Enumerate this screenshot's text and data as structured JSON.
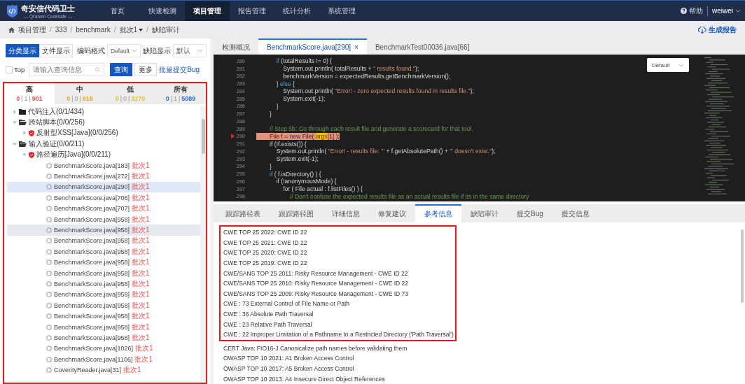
{
  "header": {
    "logo_title": "奇安信代码卫士",
    "logo_subtitle": "— Qi'anxin Codesafe —",
    "nav": [
      {
        "label": "首页",
        "selected": false
      },
      {
        "label": "快速检测",
        "selected": false
      },
      {
        "label": "项目管理",
        "selected": true
      },
      {
        "label": "报告管理",
        "selected": false
      },
      {
        "label": "统计分析",
        "selected": false
      },
      {
        "label": "系统管理",
        "selected": false
      }
    ],
    "help": "帮助",
    "user": "weiwei"
  },
  "breadcrumb": {
    "separator": "/",
    "items": [
      {
        "label": "项目管理",
        "kind": "text"
      },
      {
        "label": "333",
        "kind": "text"
      },
      {
        "label": "benchmark",
        "kind": "text"
      },
      {
        "label": "批次1",
        "kind": "dropdown"
      },
      {
        "label": "缺陷审计",
        "kind": "text"
      }
    ],
    "report_button": "生成报告"
  },
  "left": {
    "view_toggle": [
      {
        "label": "分类显示",
        "selected": true
      },
      {
        "label": "文件显示",
        "selected": false
      }
    ],
    "encoding": {
      "label": "编码格式",
      "value": "Default"
    },
    "defect_display": {
      "label": "缺陷显示",
      "value": "默认"
    },
    "top": {
      "label": "Top",
      "checked": false
    },
    "search": {
      "placeholder": "请输入查询信息"
    },
    "query_button": "查询",
    "more_button": "更多",
    "batch_link": "批量提交Bug",
    "red_frame": true,
    "count_separator": "|",
    "severity_tabs": [
      {
        "label": "高",
        "counts": [
          "0",
          "1",
          "901"
        ],
        "color": "#f0514f",
        "selected": true
      },
      {
        "label": "中",
        "counts": [
          "0",
          "0",
          "918"
        ],
        "color": "#f5a623",
        "selected": false
      },
      {
        "label": "低",
        "counts": [
          "0",
          "0",
          "3270"
        ],
        "color": "#f2c01c",
        "selected": false
      },
      {
        "label": "所有",
        "counts": [
          "0",
          "1",
          "5089"
        ],
        "color": "#2a6fd6",
        "selected": false
      }
    ],
    "tree": [
      {
        "kind": "folder",
        "label": "代码注入(0/1/434)",
        "expanded": false
      },
      {
        "kind": "folder",
        "label": "跨站脚本(0/0/256)",
        "expanded": true,
        "children": [
          {
            "kind": "rule",
            "label": "反射型XSS[Java](0/0/256)",
            "expanded": false
          }
        ]
      },
      {
        "kind": "folder",
        "label": "输入验证(0/0/211)",
        "expanded": true,
        "children": [
          {
            "kind": "rule",
            "label": "路径遍历[Java](0/0/211)",
            "expanded": true,
            "children": [
              {
                "kind": "issue",
                "file": "BenchmarkScore.java[183]",
                "batch": "批次1",
                "selected": false,
                "hovered": false
              },
              {
                "kind": "issue",
                "file": "BenchmarkScore.java[272]",
                "batch": "批次1",
                "selected": false,
                "hovered": false
              },
              {
                "kind": "issue",
                "file": "BenchmarkScore.java[290]",
                "batch": "批次1",
                "selected": true,
                "hovered": false
              },
              {
                "kind": "issue",
                "file": "BenchmarkScore.java[706]",
                "batch": "批次1",
                "selected": false,
                "hovered": false
              },
              {
                "kind": "issue",
                "file": "BenchmarkScore.java[707]",
                "batch": "批次1",
                "selected": false,
                "hovered": false
              },
              {
                "kind": "issue",
                "file": "BenchmarkScore.java[958]",
                "batch": "批次1",
                "selected": false,
                "hovered": false
              },
              {
                "kind": "issue",
                "file": "BenchmarkScore.java[958]",
                "batch": "批次1",
                "selected": false,
                "hovered": true
              },
              {
                "kind": "issue",
                "file": "BenchmarkScore.java[958]",
                "batch": "批次1",
                "selected": false,
                "hovered": false
              },
              {
                "kind": "issue",
                "file": "BenchmarkScore.java[958]",
                "batch": "批次1",
                "selected": false,
                "hovered": false
              },
              {
                "kind": "issue",
                "file": "BenchmarkScore.java[958]",
                "batch": "批次1",
                "selected": false,
                "hovered": false
              },
              {
                "kind": "issue",
                "file": "BenchmarkScore.java[958]",
                "batch": "批次1",
                "selected": false,
                "hovered": false
              },
              {
                "kind": "issue",
                "file": "BenchmarkScore.java[958]",
                "batch": "批次1",
                "selected": false,
                "hovered": false
              },
              {
                "kind": "issue",
                "file": "BenchmarkScore.java[958]",
                "batch": "批次1",
                "selected": false,
                "hovered": false
              },
              {
                "kind": "issue",
                "file": "BenchmarkScore.java[958]",
                "batch": "批次1",
                "selected": false,
                "hovered": false
              },
              {
                "kind": "issue",
                "file": "BenchmarkScore.java[958]",
                "batch": "批次1",
                "selected": false,
                "hovered": false
              },
              {
                "kind": "issue",
                "file": "BenchmarkScore.java[958]",
                "batch": "批次1",
                "selected": false,
                "hovered": false
              },
              {
                "kind": "issue",
                "file": "BenchmarkScore.java[958]",
                "batch": "批次1",
                "selected": false,
                "hovered": false
              },
              {
                "kind": "issue",
                "file": "BenchmarkScore.java[1026]",
                "batch": "批次1",
                "selected": false,
                "hovered": false
              },
              {
                "kind": "issue",
                "file": "BenchmarkScore.java[1106]",
                "batch": "批次1",
                "selected": false,
                "hovered": false
              },
              {
                "kind": "issue",
                "file": "CoverityReader.java[31]",
                "batch": "批次1",
                "selected": false,
                "hovered": false
              }
            ]
          }
        ]
      }
    ]
  },
  "code_tabs": [
    {
      "label": "检测概况",
      "selected": false
    },
    {
      "label": "BenchmarkScore.java[290]",
      "selected": true,
      "close": "×"
    },
    {
      "label": "BenchmarkTest00036.java[66]",
      "selected": false
    }
  ],
  "code": {
    "theme_select": "Default",
    "lines": [
      {
        "number": "280",
        "segments": [
          {
            "text": "            if",
            "kind": "keyword"
          },
          {
            "text": " (totalResults != 0) {",
            "kind": "plain"
          }
        ]
      },
      {
        "number": "281",
        "segments": [
          {
            "text": "                System.out.println( totalResults + ",
            "kind": "plain"
          },
          {
            "text": "\" results found.\"",
            "kind": "string"
          },
          {
            "text": ");",
            "kind": "plain"
          }
        ]
      },
      {
        "number": "282",
        "segments": [
          {
            "text": "                benchmarkVersion = expectedResults.getBenchmarkVersion();",
            "kind": "plain"
          }
        ]
      },
      {
        "number": "283",
        "segments": [
          {
            "text": "            } ",
            "kind": "plain"
          },
          {
            "text": "else",
            "kind": "keyword"
          },
          {
            "text": " {",
            "kind": "plain"
          }
        ]
      },
      {
        "number": "284",
        "segments": [
          {
            "text": "                System.out.println( ",
            "kind": "plain"
          },
          {
            "text": "\"Error! - zero expected results found in results file.\"",
            "kind": "string"
          },
          {
            "text": ");",
            "kind": "plain"
          }
        ]
      },
      {
        "number": "285",
        "segments": [
          {
            "text": "                System.exit(-1);",
            "kind": "plain"
          }
        ]
      },
      {
        "number": "286",
        "segments": [
          {
            "text": "            }",
            "kind": "plain"
          }
        ]
      },
      {
        "number": "287",
        "segments": [
          {
            "text": "        }",
            "kind": "plain"
          }
        ]
      },
      {
        "number": "288"
      },
      {
        "number": "289",
        "segments": [
          {
            "text": "        // Step 5b: Go through each result file and generate a scorecard for that tool.",
            "kind": "comment"
          }
        ]
      },
      {
        "number": "290",
        "highlighted": true,
        "breakpoint": true,
        "segments": [
          {
            "text": "        File f = ",
            "kind": "plain"
          },
          {
            "text": "new",
            "kind": "keyword"
          },
          {
            "text": " File( ",
            "kind": "plain"
          },
          {
            "text": "args",
            "kind": "match"
          },
          {
            "text": "[1] );",
            "kind": "plain"
          }
        ]
      },
      {
        "number": "291",
        "segments": [
          {
            "text": "        if (!f.exists()) {",
            "kind": "plain"
          }
        ]
      },
      {
        "number": "292",
        "segments": [
          {
            "text": "            System.out.println( ",
            "kind": "plain"
          },
          {
            "text": "\"Error! - results file: '\"",
            "kind": "string"
          },
          {
            "text": " + f.getAbsolutePath() + ",
            "kind": "plain"
          },
          {
            "text": "\"' doesn't exist.\"",
            "kind": "string"
          },
          {
            "text": ");",
            "kind": "plain"
          }
        ]
      },
      {
        "number": "293",
        "segments": [
          {
            "text": "            System.exit(-1);",
            "kind": "plain"
          }
        ]
      },
      {
        "number": "294",
        "segments": [
          {
            "text": "        }",
            "kind": "plain"
          }
        ]
      },
      {
        "number": "295",
        "segments": [
          {
            "text": "        if",
            "kind": "keyword"
          },
          {
            "text": " ( f.isDirectory() ) {",
            "kind": "plain"
          }
        ]
      },
      {
        "number": "296",
        "segments": [
          {
            "text": "            if (!anonymousMode) {",
            "kind": "plain"
          }
        ]
      },
      {
        "number": "297",
        "segments": [
          {
            "text": "                for ( File actual : f.listFiles() ) {",
            "kind": "plain"
          }
        ]
      },
      {
        "number": "298",
        "segments": [
          {
            "text": "                    // Don't confuse the expected results file as an actual results file if its in the same directory",
            "kind": "comment"
          }
        ]
      }
    ]
  },
  "detail_tabs": [
    {
      "label": "跟踪路径表",
      "selected": false
    },
    {
      "label": "跟踪路径图",
      "selected": false
    },
    {
      "label": "详细信息",
      "selected": false
    },
    {
      "label": "修复建议",
      "selected": false
    },
    {
      "label": "参考信息",
      "selected": true
    },
    {
      "label": "缺陷审计",
      "selected": false
    },
    {
      "label": "提交Bug",
      "selected": false
    },
    {
      "label": "提交信息",
      "selected": false
    }
  ],
  "references": [
    {
      "text": "CWE TOP 25 2022: CWE ID 22",
      "framed": true
    },
    {
      "text": "CWE TOP 25 2021: CWE ID 22",
      "framed": true
    },
    {
      "text": "CWE TOP 25 2020: CWE ID 22",
      "framed": true
    },
    {
      "text": "CWE TOP 25 2019: CWE ID 22",
      "framed": true
    },
    {
      "text": "CWE/SANS TOP 25 2011: Risky Resource Management - CWE ID 22",
      "framed": true
    },
    {
      "text": "CWE/SANS TOP 25 2010: Risky Resource Management - CWE ID 22",
      "framed": true
    },
    {
      "text": "CWE/SANS TOP 25 2009: Risky Resource Management - CWE ID 73",
      "framed": true
    },
    {
      "text": "CWE : 73 External Control of File Name or Path",
      "framed": true
    },
    {
      "text": "CWE : 36 Absolute Path Traversal",
      "framed": true
    },
    {
      "text": "CWE : 23 Relative Path Traversal",
      "framed": true
    },
    {
      "text": "CWE : 22 Improper Limitation of a Pathname to a Restricted Directory ('Path Traversal')",
      "framed": true
    },
    {
      "text": "CERT Java: FIO16-J Canonicalize path names before validating them",
      "framed": false
    },
    {
      "text": "OWASP TOP 10 2021: A1 Broken Access Control",
      "framed": false
    },
    {
      "text": "OWASP TOP 10 2017: A5 Broken Access Control",
      "framed": false
    },
    {
      "text": "OWASP TOP 10 2013: A4 Insecure Direct Object References",
      "framed": false
    }
  ]
}
